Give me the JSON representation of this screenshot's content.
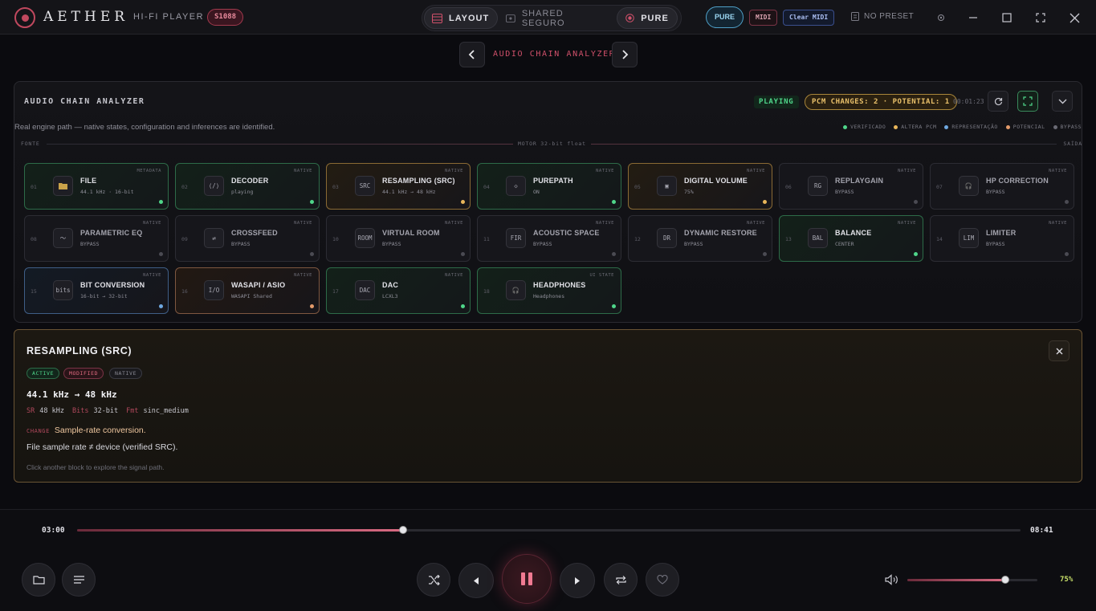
{
  "app": {
    "brand": "AETHER",
    "subtitle": "HI-FI PLAYER",
    "serial": "S1088"
  },
  "topbar": {
    "segments": [
      {
        "label": "LAYOUT",
        "icon": "layout-icon",
        "active": true
      },
      {
        "label": "SHARED SEGURO",
        "icon": "shared-icon",
        "active": false
      },
      {
        "label": "PURE",
        "icon": "record-dot-icon",
        "active": true
      }
    ],
    "pure_label": "PURE",
    "midi_label": "MIDI",
    "clear_midi_label": "Clear MIDI",
    "preset_label": "NO PRESET"
  },
  "nav": {
    "title": "AUDIO CHAIN ANALYZER"
  },
  "analyzer": {
    "title": "AUDIO CHAIN ANALYZER",
    "status": "PLAYING",
    "pcm_changes": "PCM CHANGES: 2 · POTENTIAL: 1",
    "time": "00:01:23",
    "description": "Real engine path — native states, configuration and inferences are identified.",
    "legend": [
      {
        "label": "VERIFICADO",
        "color": "#4fd68a"
      },
      {
        "label": "ALTERA PCM",
        "color": "#e9b65a"
      },
      {
        "label": "REPRESENTAÇÃO",
        "color": "#6fa8e0"
      },
      {
        "label": "POTENCIAL",
        "color": "#e39a6a"
      },
      {
        "label": "BYPASS",
        "color": "#6a6a74"
      }
    ],
    "flow": {
      "source": "FONTE",
      "engine": "MOTOR 32-bit float",
      "output": "SAÍDA"
    },
    "blocks": [
      {
        "num": "01",
        "icon_text": "",
        "icon": "folder-icon",
        "name": "FILE",
        "sub": "44.1 kHz · 16-bit",
        "tag": "METADATA",
        "state": "g"
      },
      {
        "num": "02",
        "icon_text": "⟨/⟩",
        "icon": "code-icon",
        "name": "DECODER",
        "sub": "playing",
        "tag": "NATIVE",
        "state": "g"
      },
      {
        "num": "03",
        "icon_text": "SRC",
        "icon": "src-icon",
        "name": "RESAMPLING (SRC)",
        "sub": "44.1 kHz → 48 kHz",
        "tag": "NATIVE",
        "state": "a"
      },
      {
        "num": "04",
        "icon_text": "◇",
        "icon": "diamond-icon",
        "name": "PUREPATH",
        "sub": "ON",
        "tag": "NATIVE",
        "state": "g"
      },
      {
        "num": "05",
        "icon_text": "▣",
        "icon": "volume-block-icon",
        "name": "DIGITAL VOLUME",
        "sub": "75%",
        "tag": "NATIVE",
        "state": "a"
      },
      {
        "num": "06",
        "icon_text": "RG",
        "icon": "rg-icon",
        "name": "REPLAYGAIN",
        "sub": "BYPASS",
        "tag": "NATIVE",
        "state": "off"
      },
      {
        "num": "07",
        "icon_text": "🎧",
        "icon": "headphones-icon",
        "name": "HP CORRECTION",
        "sub": "BYPASS",
        "tag": "NATIVE",
        "state": "off"
      },
      {
        "num": "08",
        "icon_text": "〜",
        "icon": "eq-wave-icon",
        "name": "PARAMETRIC EQ",
        "sub": "BYPASS",
        "tag": "NATIVE",
        "state": "off"
      },
      {
        "num": "09",
        "icon_text": "⇄",
        "icon": "crossfeed-icon",
        "name": "CROSSFEED",
        "sub": "BYPASS",
        "tag": "NATIVE",
        "state": "off"
      },
      {
        "num": "10",
        "icon_text": "ROOM",
        "icon": "room-icon",
        "name": "VIRTUAL ROOM",
        "sub": "BYPASS",
        "tag": "NATIVE",
        "state": "off"
      },
      {
        "num": "11",
        "icon_text": "FIR",
        "icon": "fir-icon",
        "name": "ACOUSTIC SPACE",
        "sub": "BYPASS",
        "tag": "NATIVE",
        "state": "off"
      },
      {
        "num": "12",
        "icon_text": "DR",
        "icon": "dr-icon",
        "name": "DYNAMIC RESTORE",
        "sub": "BYPASS",
        "tag": "NATIVE",
        "state": "off"
      },
      {
        "num": "13",
        "icon_text": "BAL",
        "icon": "balance-icon",
        "name": "BALANCE",
        "sub": "CENTER",
        "tag": "NATIVE",
        "state": "g"
      },
      {
        "num": "14",
        "icon_text": "LIM",
        "icon": "limiter-icon",
        "name": "LIMITER",
        "sub": "BYPASS",
        "tag": "NATIVE",
        "state": "off"
      },
      {
        "num": "15",
        "icon_text": "bits",
        "icon": "bits-icon",
        "name": "BIT CONVERSION",
        "sub": "16-bit → 32-bit",
        "tag": "NATIVE",
        "state": "b"
      },
      {
        "num": "16",
        "icon_text": "I/O",
        "icon": "io-icon",
        "name": "WASAPI / ASIO",
        "sub": "WASAPI Shared",
        "tag": "NATIVE",
        "state": "o"
      },
      {
        "num": "17",
        "icon_text": "DAC",
        "icon": "dac-icon",
        "name": "DAC",
        "sub": "LCXL3",
        "tag": "NATIVE",
        "state": "g"
      },
      {
        "num": "18",
        "icon_text": "🎧",
        "icon": "headphones-icon",
        "name": "HEADPHONES",
        "sub": "Headphones",
        "tag": "UI STATE",
        "state": "g"
      }
    ]
  },
  "detail": {
    "title": "RESAMPLING (SRC)",
    "chips": [
      {
        "label": "ACTIVE",
        "color": "#4fd68a"
      },
      {
        "label": "MODIFIED",
        "color": "#e06a80"
      },
      {
        "label": "NATIVE",
        "color": "#8a8a94"
      }
    ],
    "freq": "44.1 kHz → 48 kHz",
    "params": [
      {
        "k": "SR",
        "v": "48 kHz"
      },
      {
        "k": "Bits",
        "v": "32-bit"
      },
      {
        "k": "Fmt",
        "v": "sinc_medium"
      }
    ],
    "change_key": "CHANGE",
    "change_text": "Sample-rate conversion.",
    "reason": "File sample rate ≠ device (verified SRC).",
    "hint": "Click another block to explore the signal path."
  },
  "player": {
    "current_time": "03:00",
    "total_time": "08:41",
    "progress": 0.3455,
    "volume": 0.75,
    "volume_label": "75%"
  }
}
